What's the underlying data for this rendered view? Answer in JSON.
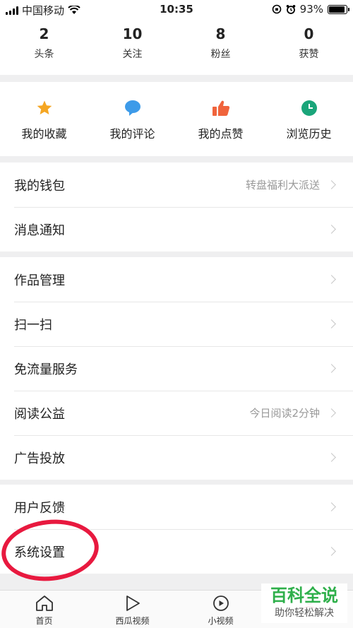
{
  "status_bar": {
    "carrier": "中国移动",
    "time": "10:35",
    "battery": "93%",
    "battery_level": 0.93
  },
  "stats": [
    {
      "value": "2",
      "label": "头条"
    },
    {
      "value": "10",
      "label": "关注"
    },
    {
      "value": "8",
      "label": "粉丝"
    },
    {
      "value": "0",
      "label": "获赞"
    }
  ],
  "shortcuts": [
    {
      "label": "我的收藏",
      "icon": "star-icon",
      "color": "#f5a623"
    },
    {
      "label": "我的评论",
      "icon": "comment-icon",
      "color": "#3d9be9"
    },
    {
      "label": "我的点赞",
      "icon": "thumbs-up-icon",
      "color": "#f0643c"
    },
    {
      "label": "浏览历史",
      "icon": "clock-icon",
      "color": "#1aa57a"
    }
  ],
  "menu_groups": [
    [
      {
        "title": "我的钱包",
        "extra": "转盘福利大派送"
      },
      {
        "title": "消息通知",
        "extra": ""
      }
    ],
    [
      {
        "title": "作品管理",
        "extra": ""
      },
      {
        "title": "扫一扫",
        "extra": ""
      },
      {
        "title": "免流量服务",
        "extra": ""
      },
      {
        "title": "阅读公益",
        "extra": "今日阅读2分钟"
      },
      {
        "title": "广告投放",
        "extra": ""
      }
    ],
    [
      {
        "title": "用户反馈",
        "extra": ""
      },
      {
        "title": "系统设置",
        "extra": ""
      }
    ]
  ],
  "tabbar": [
    {
      "label": "首页",
      "icon": "home-icon"
    },
    {
      "label": "西瓜视频",
      "icon": "play-icon"
    },
    {
      "label": "小视频",
      "icon": "short-video-icon"
    },
    {
      "label": "",
      "icon": "profile-icon"
    }
  ],
  "watermark": {
    "title": "百科全说",
    "subtitle": "助你轻松解决"
  },
  "annotation_color": "#e8193f"
}
